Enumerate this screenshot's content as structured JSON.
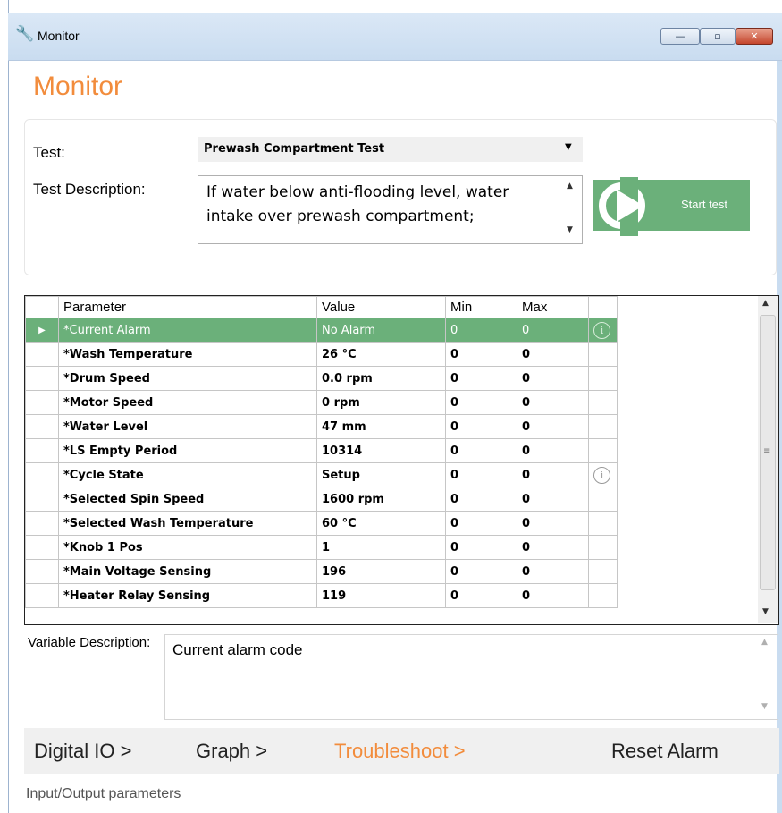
{
  "window": {
    "title": "Monitor",
    "minimize_glyph": "—",
    "maximize_glyph": "▫",
    "close_glyph": "✕",
    "icon": "wrench-icon"
  },
  "page": {
    "title": "Monitor"
  },
  "test": {
    "label": "Test:",
    "selected": "Prewash Compartment Test",
    "arrow": "▼"
  },
  "test_description": {
    "label": "Test Description:",
    "text": "If water below anti-flooding level, water intake over prewash compartment;",
    "scroll_up": "▲",
    "scroll_down": "▼"
  },
  "start_test": {
    "label": "Start test"
  },
  "grid": {
    "columns": [
      "Parameter",
      "Value",
      "Min",
      "Max"
    ],
    "info_glyph": "i",
    "active_marker": "▶",
    "rows": [
      {
        "parameter": "*Current Alarm",
        "value": "No Alarm",
        "min": "0",
        "max": "0",
        "info": true,
        "active": true
      },
      {
        "parameter": "*Wash Temperature",
        "value": "26 °C",
        "min": "0",
        "max": "0",
        "info": false
      },
      {
        "parameter": "*Drum Speed",
        "value": "0.0 rpm",
        "min": "0",
        "max": "0",
        "info": false
      },
      {
        "parameter": "*Motor Speed",
        "value": "0 rpm",
        "min": "0",
        "max": "0",
        "info": false
      },
      {
        "parameter": "*Water Level",
        "value": "47 mm",
        "min": "0",
        "max": "0",
        "info": false
      },
      {
        "parameter": "*LS Empty Period",
        "value": "10314",
        "min": "0",
        "max": "0",
        "info": false
      },
      {
        "parameter": "*Cycle State",
        "value": "Setup",
        "min": "0",
        "max": "0",
        "info": true
      },
      {
        "parameter": "*Selected Spin Speed",
        "value": "1600 rpm",
        "min": "0",
        "max": "0",
        "info": false
      },
      {
        "parameter": "*Selected Wash Temperature",
        "value": "60 °C",
        "min": "0",
        "max": "0",
        "info": false
      },
      {
        "parameter": "*Knob 1 Pos",
        "value": "1",
        "min": "0",
        "max": "0",
        "info": false
      },
      {
        "parameter": "*Main Voltage Sensing",
        "value": "196",
        "min": "0",
        "max": "0",
        "info": false
      },
      {
        "parameter": "*Heater Relay Sensing",
        "value": "119",
        "min": "0",
        "max": "0",
        "info": false
      }
    ],
    "scroll_up": "▲",
    "scroll_down": "▼",
    "grip": "≡"
  },
  "variable_description": {
    "label": "Variable Description:",
    "text": "Current alarm code",
    "scroll_up": "▲",
    "scroll_down": "▼"
  },
  "nav": {
    "digital_io": "Digital IO >",
    "graph": "Graph >",
    "troubleshoot": "Troubleshoot >",
    "reset_alarm": "Reset Alarm"
  },
  "status": "Input/Output parameters",
  "colors": {
    "accent": "#f28c3c",
    "green": "#6bb07a"
  }
}
